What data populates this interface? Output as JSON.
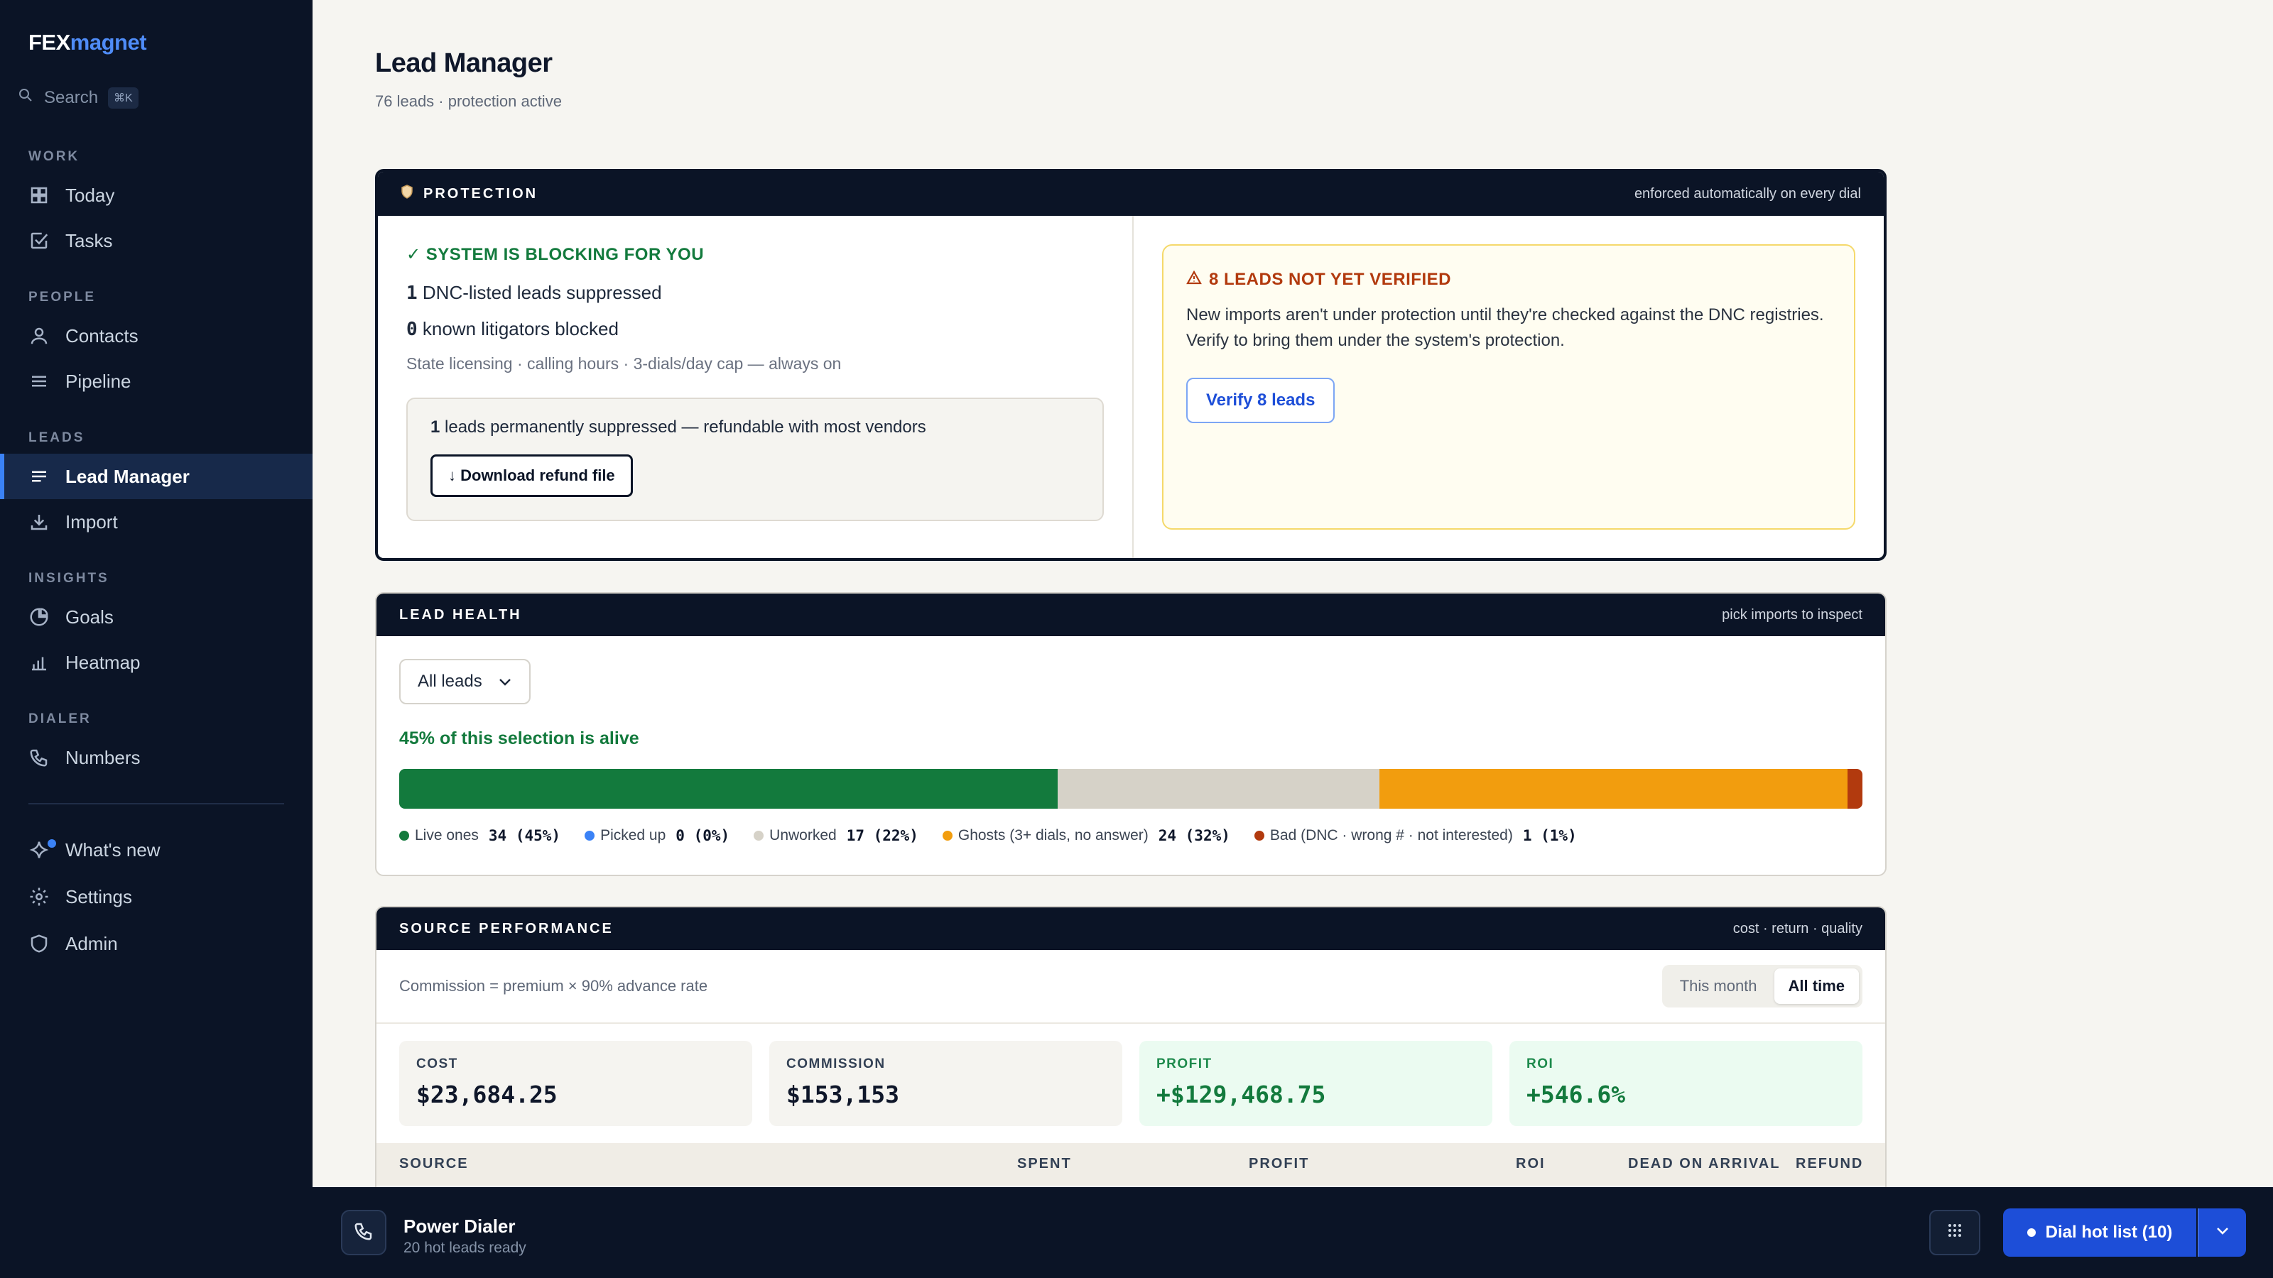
{
  "brand": {
    "part1": "FEX",
    "part2": "magnet"
  },
  "search": {
    "label": "Search",
    "shortcut": "⌘K"
  },
  "sidebar": {
    "sections": [
      {
        "label": "WORK"
      },
      {
        "label": "PEOPLE"
      },
      {
        "label": "LEADS"
      },
      {
        "label": "INSIGHTS"
      },
      {
        "label": "DIALER"
      }
    ],
    "items": [
      {
        "label": "Today",
        "icon": "grid-icon"
      },
      {
        "label": "Tasks",
        "icon": "checkbox-icon"
      },
      {
        "label": "Contacts",
        "icon": "user-icon"
      },
      {
        "label": "Pipeline",
        "icon": "menu-icon"
      },
      {
        "label": "Lead Manager",
        "icon": "list-icon",
        "active": true
      },
      {
        "label": "Import",
        "icon": "download-icon"
      },
      {
        "label": "Goals",
        "icon": "pie-icon"
      },
      {
        "label": "Heatmap",
        "icon": "bar-chart-icon"
      },
      {
        "label": "Numbers",
        "icon": "phone-icon"
      }
    ],
    "footer": [
      {
        "label": "What's new",
        "icon": "sparkle-icon"
      },
      {
        "label": "Settings",
        "icon": "gear-icon"
      },
      {
        "label": "Admin",
        "icon": "shield-icon"
      }
    ]
  },
  "page": {
    "title": "Lead Manager",
    "subtitle": "76 leads · protection active"
  },
  "protection": {
    "title": "PROTECTION",
    "right_note": "enforced automatically on every dial",
    "blocking_title": "✓ SYSTEM IS BLOCKING FOR YOU",
    "dnc_count": "1",
    "dnc_text": "DNC-listed leads suppressed",
    "litigator_count": "0",
    "litigator_text": "known litigators blocked",
    "rules": "State licensing · calling hours · 3-dials/day cap — always on",
    "refund_count": "1",
    "refund_text": "leads permanently suppressed — refundable with most vendors",
    "refund_button": "↓ Download refund file",
    "warn_title": "8 LEADS NOT YET VERIFIED",
    "warn_text": "New imports aren't under protection until they're checked against the DNC registries. Verify to bring them under the system's protection.",
    "verify_button": "Verify 8 leads"
  },
  "health": {
    "title": "LEAD HEALTH",
    "right_note": "pick imports to inspect",
    "selector": "All leads",
    "alive_text": "45% of this selection is alive",
    "segments": [
      {
        "label": "Live ones",
        "value": "34 (45%)",
        "fraction": 0.45,
        "color": "#137a3d"
      },
      {
        "label": "Picked up",
        "value": "0 (0%)",
        "fraction": 0.0,
        "color": "#3b82f6"
      },
      {
        "label": "Unworked",
        "value": "17 (22%)",
        "fraction": 0.22,
        "color": "#d6d2c8"
      },
      {
        "label": "Ghosts (3+ dials, no answer)",
        "value": "24 (32%)",
        "fraction": 0.32,
        "color": "#f29d0e"
      },
      {
        "label": "Bad (DNC · wrong # · not interested)",
        "value": "1 (1%)",
        "fraction": 0.01,
        "color": "#b23a0e"
      }
    ]
  },
  "source": {
    "title": "SOURCE PERFORMANCE",
    "right_note": "cost · return · quality",
    "commission_note": "Commission = premium × 90% advance rate",
    "toggle": [
      "This month",
      "All time"
    ],
    "kpis": [
      {
        "label": "COST",
        "value": "$23,684.25"
      },
      {
        "label": "COMMISSION",
        "value": "$153,153"
      },
      {
        "label": "PROFIT",
        "value": "+$129,468.75"
      },
      {
        "label": "ROI",
        "value": "+546.6%"
      }
    ],
    "columns": [
      "SOURCE",
      "SPENT",
      "PROFIT",
      "ROI",
      "DEAD ON ARRIVAL",
      "REFUND"
    ]
  },
  "dialer": {
    "title": "Power Dialer",
    "subtitle": "20 hot leads ready",
    "dial_button": "Dial hot list (10)"
  }
}
